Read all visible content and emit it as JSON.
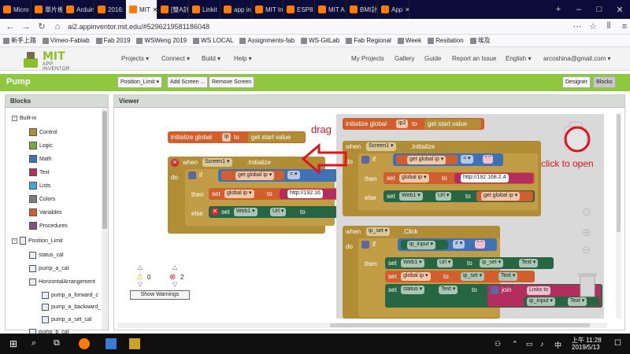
{
  "browser": {
    "tabs": [
      "Micro",
      "單片機學",
      "Arduin",
      "2016:",
      "MIT",
      "[雙A計劃",
      "Linkit",
      "app in",
      "MIT In",
      "ESP8",
      "MIT A",
      "BMI計",
      "App"
    ],
    "url": "ai2.appinventor.mit.edu/#5296219581186048",
    "bookmarks": [
      "新手上路",
      "Vimeo-Fablab",
      "Fab 2019",
      "WSWeng 2019",
      "WS LOCAL",
      "Assignments-fab",
      "WS-GitLab",
      "Fab Regional",
      "Week",
      "Resitation",
      "埃及"
    ]
  },
  "header": {
    "logo_mit": "MIT",
    "logo_sub": "APP INVENTOR",
    "menus": [
      "Projects ▾",
      "Connect ▾",
      "Build ▾",
      "Help ▾"
    ],
    "right_menus": [
      "My Projects",
      "Gallery",
      "Guide",
      "Report an Issue",
      "English ▾",
      "arcoshina@gmail.com ▾"
    ]
  },
  "toolbar": {
    "project": "Pump",
    "screen_select": "Position_Limit ▾",
    "add_screen": "Add Screen ...",
    "remove_screen": "Remove Screen",
    "designer": "Designer",
    "blocks": "Blocks"
  },
  "blocks_panel": {
    "title": "Blocks",
    "builtin": "Built-in",
    "categories": [
      {
        "label": "Control",
        "color": "#b18e35"
      },
      {
        "label": "Logic",
        "color": "#77ab41"
      },
      {
        "label": "Math",
        "color": "#3f71b5"
      },
      {
        "label": "Text",
        "color": "#b32d5e"
      },
      {
        "label": "Lists",
        "color": "#49a6d4"
      },
      {
        "label": "Colors",
        "color": "#7d7d7d"
      },
      {
        "label": "Variables",
        "color": "#d05f2d"
      },
      {
        "label": "Procedures",
        "color": "#7c5385"
      }
    ],
    "screen": "Position_Limit",
    "components": [
      "status_cal",
      "pump_a_cal",
      "HorizontalArrangement",
      "pump_a_forward_c",
      "pump_a_backward_",
      "pump_a_set_cal",
      "pump_b_cal"
    ]
  },
  "viewer": {
    "title": "Viewer",
    "blocks": {
      "init1": "initialize global",
      "ip": "ip",
      "to": "to",
      "get_start": "get start value",
      "when": "when",
      "screen1": "Screen1 ▾",
      "initialize": ".Initialize",
      "do": "do",
      "if": "if",
      "then": "then",
      "else": "else",
      "get_global_ip": "get global ip ▾",
      "eq": "= ▾",
      "set": "set",
      "set_global_ip": "global ip ▾",
      "http": "http://192.16",
      "web1": "Web1 ▾",
      "url": "Url ▾",
      "ip2": "ip2",
      "http2": "http://192.168.2.4",
      "get_global_ip2": "get global ip ▾",
      "ip_set": "ip_set ▾",
      "click": ".Click",
      "ip_input": "ip_input ▾",
      "neq": "≠ ▾",
      "text": "Text ▾",
      "status": "status ▾",
      "join": "join",
      "links_to": "Links to"
    },
    "annotations": {
      "drag": "drag",
      "click_to_open": "click to open"
    },
    "warnings": {
      "warn_count": "0",
      "error_count": "2",
      "show_warnings": "Show Warnings"
    }
  },
  "taskbar": {
    "time": "上午 11:28",
    "date": "2019/5/13"
  }
}
